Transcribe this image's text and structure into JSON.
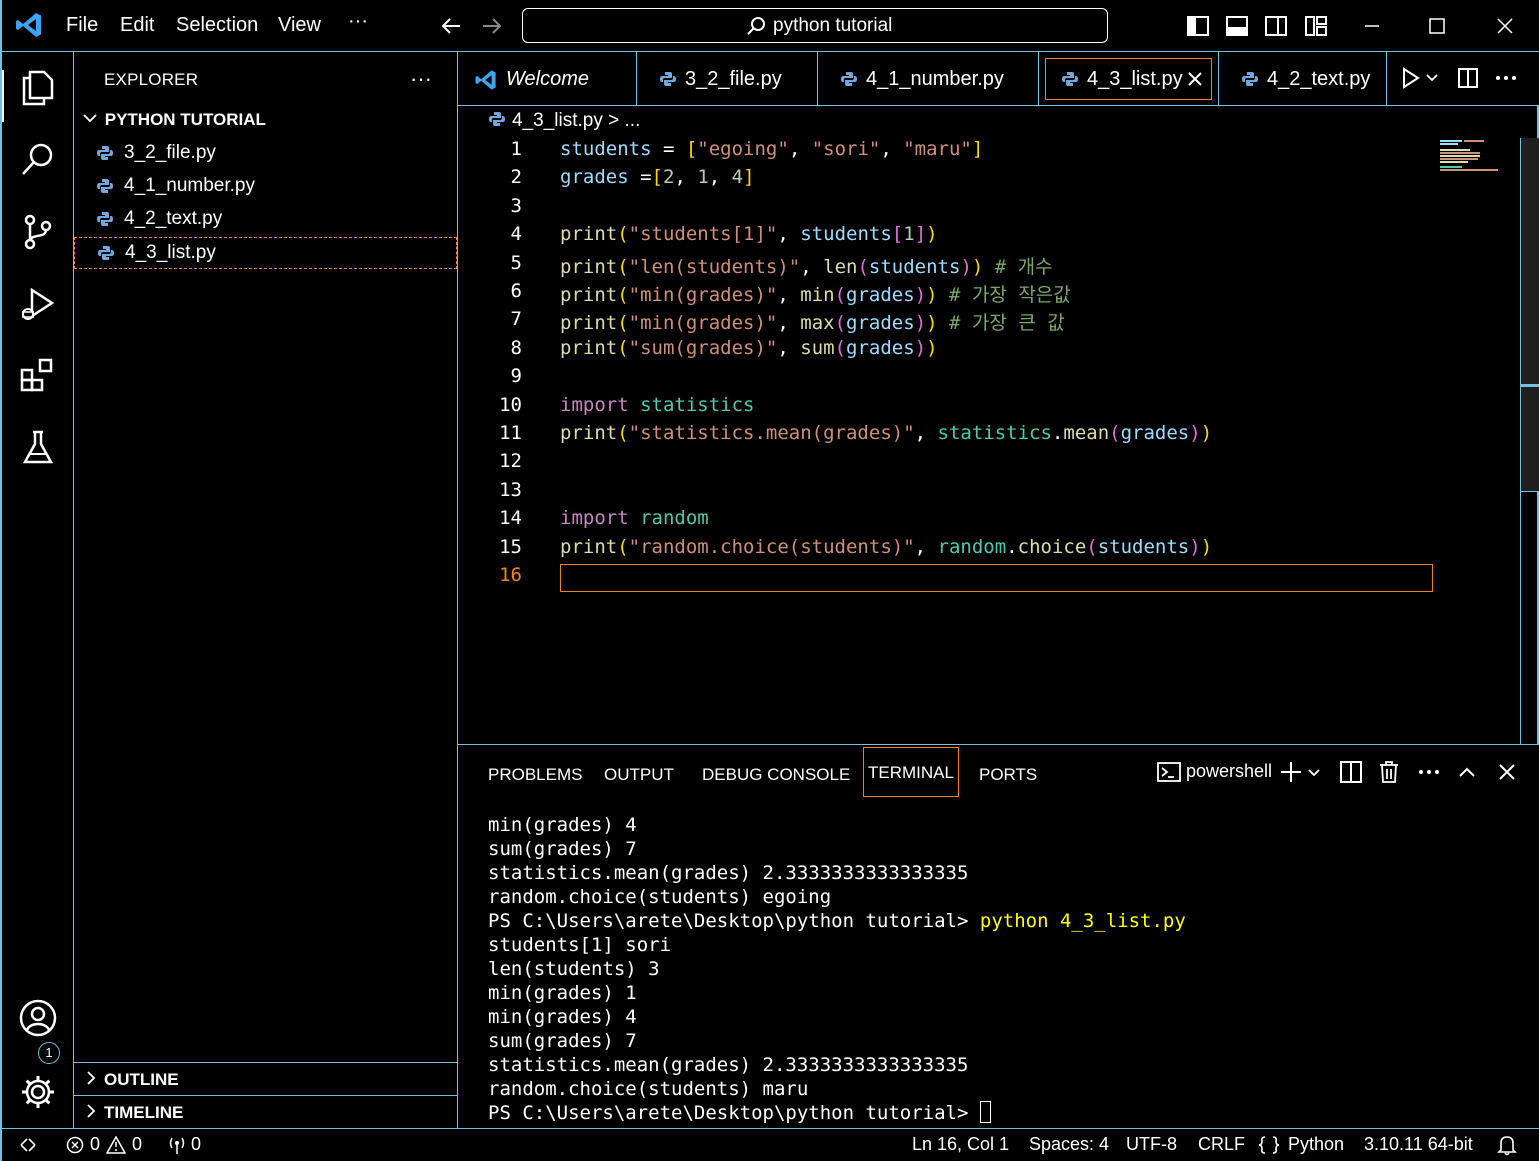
{
  "menu": {
    "items": [
      "File",
      "Edit",
      "Selection",
      "View",
      "···"
    ],
    "search_text": "python tutorial"
  },
  "sidebar": {
    "title": "EXPLORER",
    "more": "···",
    "folder": "PYTHON TUTORIAL",
    "files": [
      "3_2_file.py",
      "4_1_number.py",
      "4_2_text.py",
      "4_3_list.py"
    ],
    "selected_file": "4_3_list.py",
    "sections": [
      "OUTLINE",
      "TIMELINE"
    ]
  },
  "tabs": [
    {
      "label": "Welcome",
      "icon": "vscode-icon"
    },
    {
      "label": "3_2_file.py",
      "icon": "python-icon"
    },
    {
      "label": "4_1_number.py",
      "icon": "python-icon"
    },
    {
      "label": "4_3_list.py",
      "icon": "python-icon",
      "active": true
    },
    {
      "label": "4_2_text.py",
      "icon": "python-icon"
    }
  ],
  "breadcrumb": {
    "file": "4_3_list.py",
    "sep": ">",
    "rest": "..."
  },
  "editor": {
    "line_numbers": [
      "1",
      "2",
      "3",
      "4",
      "5",
      "6",
      "7",
      "8",
      "9",
      "10",
      "11",
      "12",
      "13",
      "14",
      "15",
      "16"
    ],
    "current_line": "16"
  },
  "panel": {
    "tabs": [
      "PROBLEMS",
      "OUTPUT",
      "DEBUG CONSOLE",
      "TERMINAL",
      "PORTS"
    ],
    "active_tab": "TERMINAL",
    "shell": "powershell",
    "terminal": {
      "lines_before": [
        "min(grades) 4",
        "sum(grades) 7",
        "statistics.mean(grades) 2.3333333333333335",
        "random.choice(students) egoing"
      ],
      "prompt": "PS C:\\Users\\arete\\Desktop\\python tutorial> ",
      "command": "python 4_3_list.py",
      "lines_after": [
        "students[1] sori",
        "len(students) 3",
        "min(grades) 1",
        "min(grades) 4",
        "sum(grades) 7",
        "statistics.mean(grades) 2.3333333333333335",
        "random.choice(students) maru"
      ],
      "final_prompt": "PS C:\\Users\\arete\\Desktop\\python tutorial> "
    }
  },
  "status": {
    "errors": "0",
    "warnings": "0",
    "ports": "0",
    "position": "Ln 16, Col 1",
    "spaces": "Spaces: 4",
    "encoding": "UTF-8",
    "eol": "CRLF",
    "language": "Python",
    "interpreter": "3.10.11 64-bit"
  },
  "activity": {
    "accounts_badge": "1"
  },
  "colors": {
    "border": "#6fc3df",
    "active_border": "#f38518",
    "keyword": "#c586c0",
    "variable": "#9cdcfe",
    "function": "#dcdcaa",
    "string": "#ce9178",
    "number": "#b5cea8",
    "class": "#4ec9b0",
    "comment": "#7ca668",
    "bracket1": "#ffd700",
    "bracket2": "#da70d6",
    "terminal_command": "#ffff00"
  }
}
